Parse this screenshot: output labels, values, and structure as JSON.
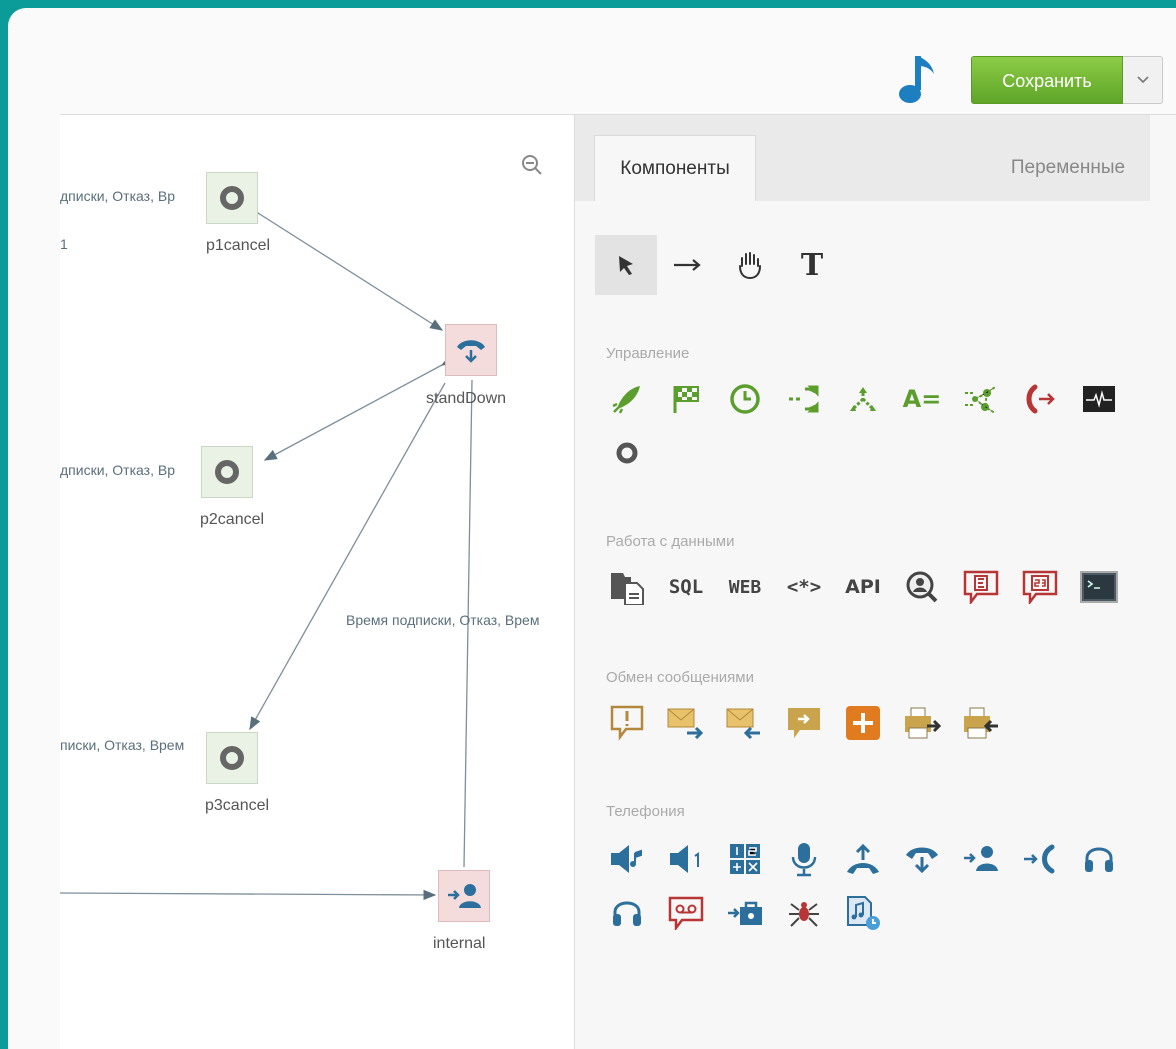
{
  "toolbar": {
    "save_label": "Сохранить",
    "dropdown_icon": "chevron-down-icon",
    "music_icon": "music-note-icon",
    "music_color": "#1d7fbf",
    "save_color": "#6cb333"
  },
  "canvas": {
    "zoom_icon": "zoom-out-icon",
    "nodes": [
      {
        "id": "p1cancel",
        "label": "p1cancel"
      },
      {
        "id": "standDown",
        "label": "standDown"
      },
      {
        "id": "p2cancel",
        "label": "p2cancel"
      },
      {
        "id": "p3cancel",
        "label": "p3cancel"
      },
      {
        "id": "internal",
        "label": "internal"
      }
    ],
    "edge_labels": {
      "e1": "дписки, Отказ, Вр",
      "e1b": "1",
      "e2": "дписки, Отказ, Вр",
      "e3": "Время подписки, Отказ, Врем",
      "e4": "писки, Отказ, Врем"
    }
  },
  "panel": {
    "tabs": [
      {
        "label": "Компоненты",
        "active": true
      },
      {
        "label": "Переменные",
        "active": false
      }
    ],
    "tools": [
      "pointer-icon",
      "arrow-right-icon",
      "hand-icon",
      "text-icon"
    ],
    "text_tool_label": "T",
    "sections": [
      {
        "title": "Управление",
        "icons": [
          "rocket-icon",
          "flag-icon",
          "clock-icon",
          "split-icon",
          "branch-icon",
          "assign-icon",
          "random-icon",
          "exit-call-icon",
          "monitor-icon",
          "stop-icon"
        ]
      },
      {
        "title": "Работа с данными",
        "icons": [
          "file-icon",
          "sql-icon",
          "web-icon",
          "regex-icon",
          "api-icon",
          "search-user-icon",
          "email-data-icon",
          "s3-icon",
          "terminal-icon"
        ],
        "labels": {
          "sql": "SQL",
          "web": "WEB",
          "regex": "<*>",
          "api": "API",
          "assign": "A="
        }
      },
      {
        "title": "Обмен сообщениями",
        "icons": [
          "alert-icon",
          "mail-send-icon",
          "mail-receive-icon",
          "chat-icon",
          "plus-icon",
          "fax-send-icon",
          "fax-receive-icon"
        ]
      },
      {
        "title": "Телефония",
        "icons": [
          "play-sound-icon",
          "play-number-icon",
          "dtmf-icon",
          "microphone-icon",
          "pickup-icon",
          "hangup-icon",
          "transfer-user-icon",
          "transfer-call-icon",
          "headset-icon",
          "headset2-icon",
          "voicemail-icon",
          "transfer-dept-icon",
          "spider-icon",
          "music-file-icon"
        ]
      }
    ]
  }
}
